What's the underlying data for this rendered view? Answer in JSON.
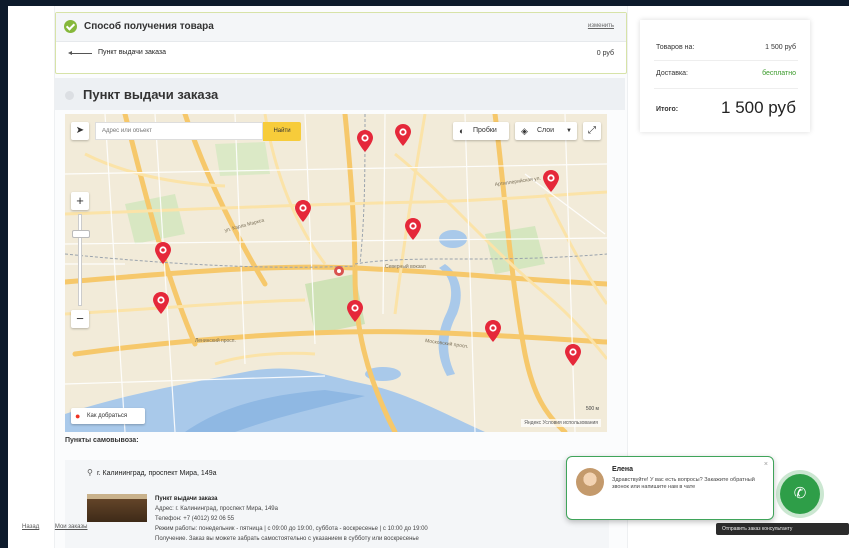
{
  "delivery": {
    "title": "Способ получения товара",
    "change": "изменить",
    "option": "Пункт выдачи заказа",
    "price": "0 руб"
  },
  "pickup": {
    "title": "Пункт выдачи заказа"
  },
  "map": {
    "search_placeholder": "Адрес или объект",
    "find": "Найти",
    "traffic": "Пробки",
    "layers": "Слои",
    "route": "Как добраться",
    "scale": "500 м",
    "credit": "Яндекс  Условия использования",
    "icons": {
      "locate": "navigation-arrow-icon",
      "traffic": "traffic-light-icon",
      "layers": "layers-icon",
      "fullscreen": "expand-icon",
      "pin": "map-pin-icon"
    },
    "pins_count": 10
  },
  "points": {
    "label": "Пункты самовывоза:",
    "address": "г. Калининград, проспект Мира, 149а",
    "name": "Пункт выдачи заказа",
    "addr_full": "Адрес: г. Калининград, проспект Мира, 149а",
    "phone": "Телефон: +7 (4012) 92 06 55",
    "hours": "Режим работы: понедельник - пятница | с 09:00 до 19:00, суббота - воскресенье | с 10:00 до 19:00",
    "extra": "Получение. Заказ вы можете забрать самостоятельно с указанием в субботу или воскресенье"
  },
  "summary": {
    "goods_label": "Товаров на:",
    "goods_value": "1 500 руб",
    "delivery_label": "Доставка:",
    "delivery_value": "бесплатно",
    "total_label": "Итого:",
    "total_value": "1 500 руб",
    "colors": {
      "free": "#3a9a2a"
    }
  },
  "nav": {
    "back": "Назад",
    "main": "Мои заказы"
  },
  "chat": {
    "name": "Елена",
    "message": "Здравствуйте! У вас есть вопросы? Закажите обратный звонок или напишите нам в чате",
    "close": "×",
    "callback": "Отправить заказ консультанту"
  },
  "colors": {
    "accent_green": "#2e9e48",
    "pin_red": "#e5283a",
    "find_yellow": "#f7cc3a"
  }
}
